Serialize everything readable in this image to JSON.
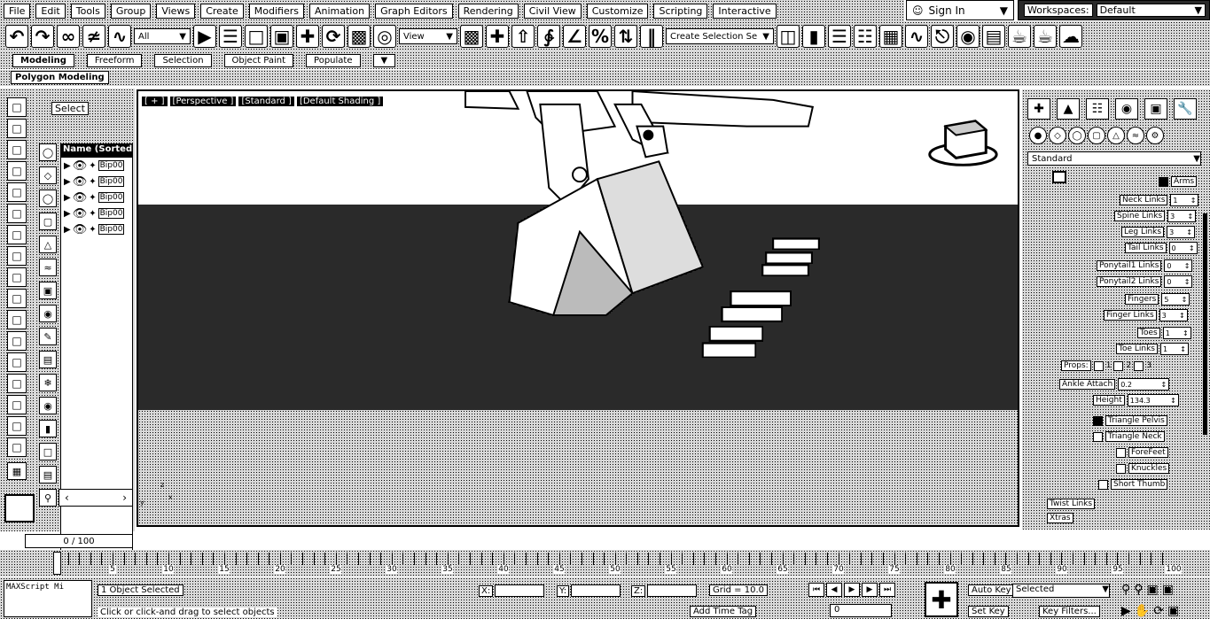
{
  "menu": [
    "File",
    "Edit",
    "Tools",
    "Group",
    "Views",
    "Create",
    "Modifiers",
    "Animation",
    "Graph Editors",
    "Rendering",
    "Civil View",
    "Customize",
    "Scripting",
    "Interactive"
  ],
  "account": {
    "signin_label": "Sign In",
    "user_icon": "user-icon"
  },
  "workspace": {
    "label": "Workspaces:",
    "value": "Default"
  },
  "toolbar": {
    "selection_filter": "All",
    "ref_coord": "View",
    "named_selection": "Create Selection Se"
  },
  "ribbon": {
    "tabs": [
      "Modeling",
      "Freeform",
      "Selection",
      "Object Paint",
      "Populate"
    ],
    "active_tab": "Modeling",
    "sub_label": "Polygon Modeling"
  },
  "scene_explorer": {
    "title": "Select",
    "column_header": "Name (Sorted A",
    "rows": [
      "Bip00",
      "Bip00",
      "Bip00",
      "Bip00",
      "Bip00"
    ]
  },
  "viewport": {
    "labels": [
      "[ + ]",
      "[Perspective ]",
      "[Standard ]",
      "[Default Shading ]"
    ],
    "axis_z": "z",
    "axis_x": "x",
    "axis_y": "y"
  },
  "command_panel": {
    "category": "Standard",
    "params": {
      "arms_label": "Arms",
      "neck_links": "Neck Links",
      "spine_links": "Spine Links",
      "leg_links": "Leg Links",
      "tail_links": "Tail Links",
      "ponytail1": "Ponytail1 Links",
      "ponytail2": "Ponytail2 Links",
      "fingers": "Fingers",
      "finger_links": "Finger Links",
      "toes": "Toes",
      "toe_links": "Toe Links",
      "props": "Props:",
      "prop1": "1",
      "prop2": "2",
      "prop3": "3",
      "ankle_attach": "Ankle Attach",
      "height": "Height",
      "triangle_pelvis": "Triangle Pelvis",
      "triangle_neck": "Triangle Neck",
      "forefeet": "ForeFeet",
      "knuckles": "Knuckles",
      "short_thumb": "Short Thumb",
      "twist_links": "Twist Links",
      "xtras": "Xtras"
    },
    "values": {
      "neck": "1",
      "spine": "3",
      "leg": "3",
      "tail": "0",
      "ponytail1": "0",
      "ponytail2": "0",
      "fingers": "5",
      "finger_links": "3",
      "toes": "1",
      "toe_links": "1",
      "ankle": "0.2",
      "height": "134.3"
    },
    "checks": {
      "arms": true,
      "triangle_pelvis": true,
      "triangle_neck": false,
      "forefeet": false,
      "knuckles": false,
      "short_thumb": false
    }
  },
  "timeline": {
    "frame_range": "0 / 100",
    "tick_labels": [
      "5",
      "10",
      "15",
      "20",
      "25",
      "30",
      "35",
      "40",
      "45",
      "50",
      "55",
      "60",
      "65",
      "70",
      "75",
      "80",
      "85",
      "90",
      "95",
      "100"
    ],
    "current_frame": 0
  },
  "status": {
    "maxscript": "MAXScript Mi",
    "selection": "1 Object Selected",
    "prompt": "Click or click-and drag to select objects",
    "x_label": "X:",
    "y_label": "Y:",
    "z_label": "Z:",
    "grid": "Grid = 10.0",
    "add_time_tag": "Add Time Tag",
    "frame": "0",
    "auto_key": "Auto Key",
    "set_key": "Set Key",
    "selected": "Selected",
    "key_filters": "Key Filters..."
  }
}
